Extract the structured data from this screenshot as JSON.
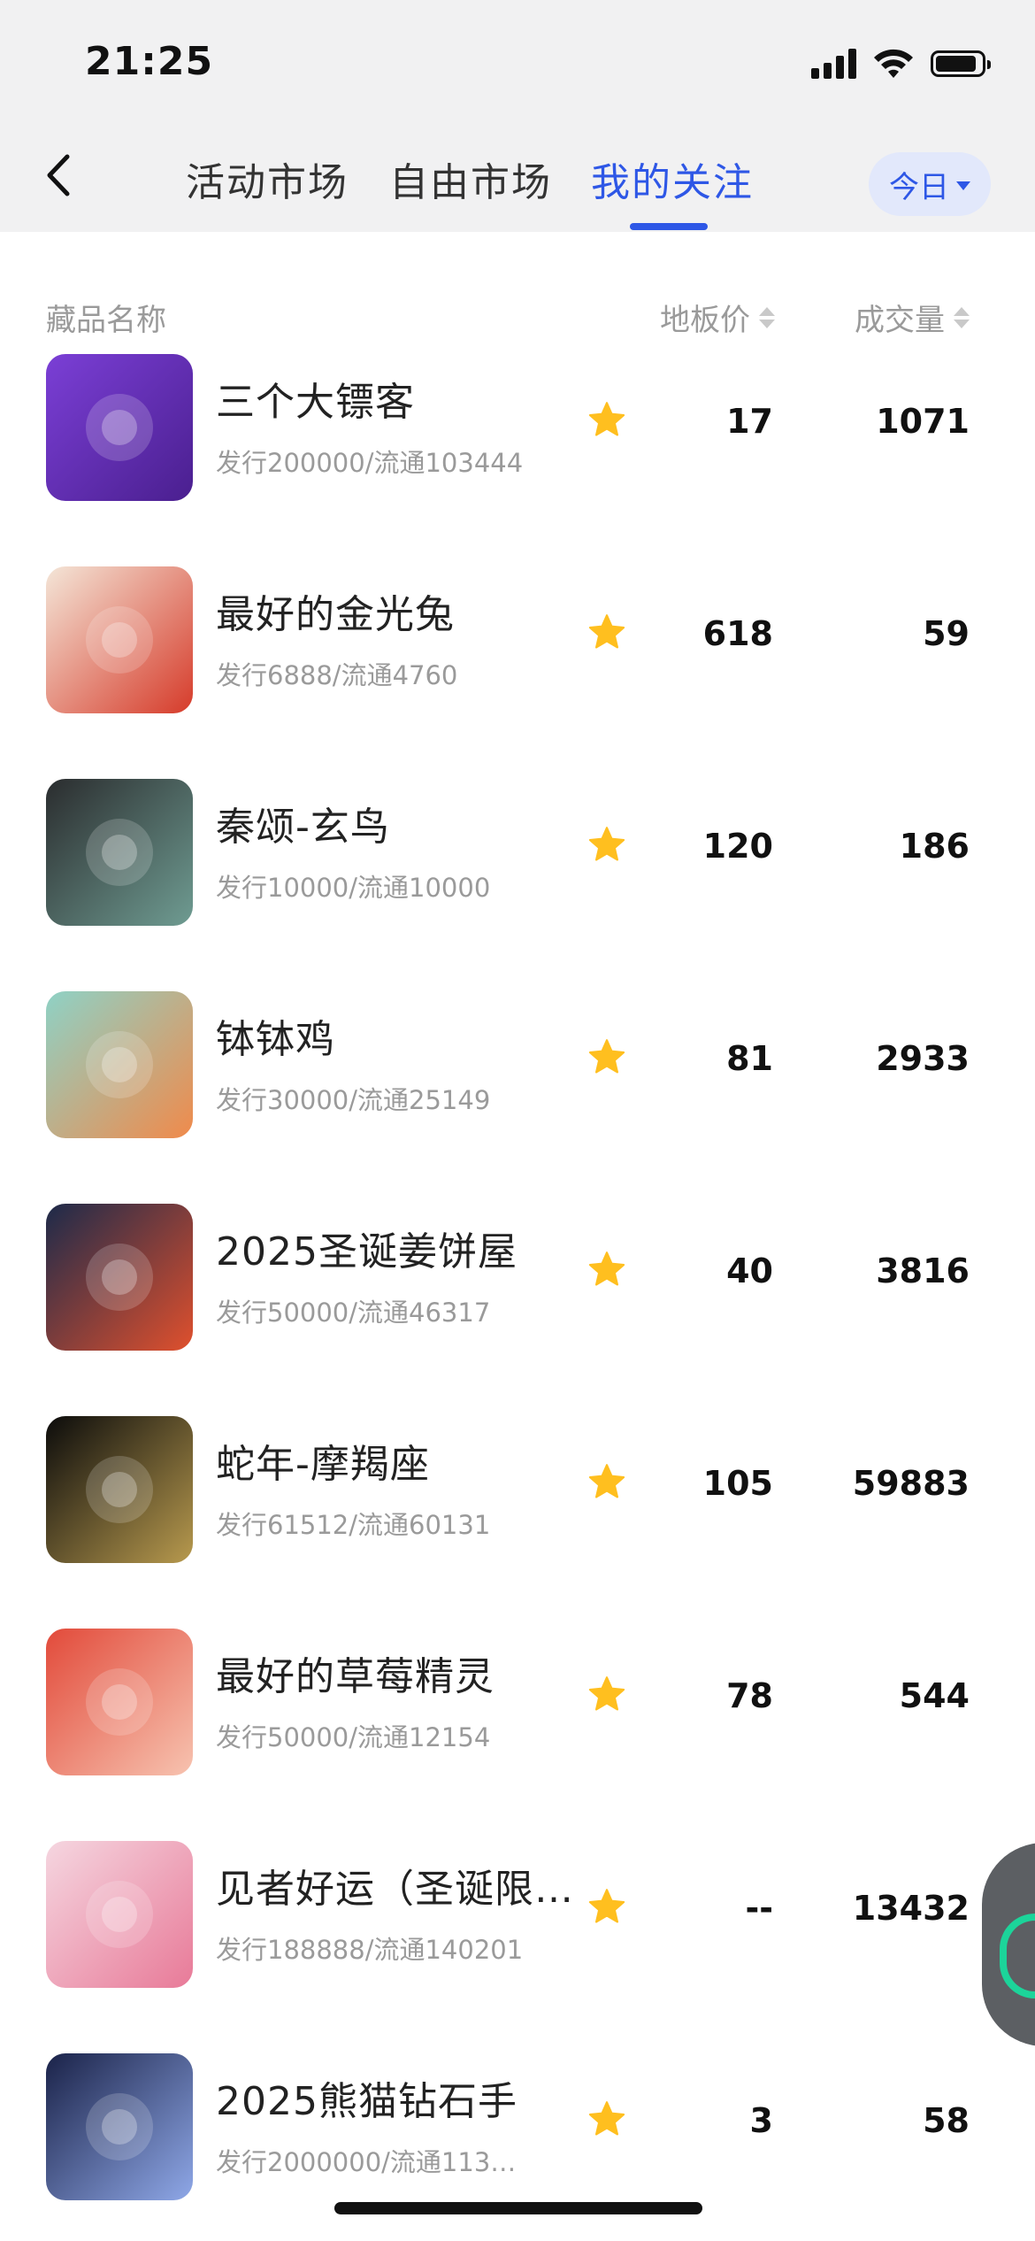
{
  "status_bar": {
    "time": "21:25"
  },
  "nav": {
    "tabs": [
      {
        "label": "活动市场"
      },
      {
        "label": "自由市场"
      },
      {
        "label": "我的关注"
      }
    ],
    "active_tab": "我的关注",
    "period_button": "今日"
  },
  "columns": {
    "name": "藏品名称",
    "floor_price": "地板价",
    "volume": "成交量"
  },
  "items": [
    {
      "name": "三个大镖客",
      "supply": "发行200000/流通103444",
      "price": "17",
      "volume": "1071",
      "thumb_bg": [
        "#7b3fd6",
        "#4a1f8f"
      ]
    },
    {
      "name": "最好的金光兔",
      "supply": "发行6888/流通4760",
      "price": "618",
      "volume": "59",
      "thumb_bg": [
        "#f4e6d8",
        "#d63b2a"
      ]
    },
    {
      "name": "秦颂-玄鸟",
      "supply": "发行10000/流通10000",
      "price": "120",
      "volume": "186",
      "thumb_bg": [
        "#2a2c2e",
        "#6f9c92"
      ]
    },
    {
      "name": "钵钵鸡",
      "supply": "发行30000/流通25149",
      "price": "81",
      "volume": "2933",
      "thumb_bg": [
        "#8ed2c6",
        "#f08a4b"
      ]
    },
    {
      "name": "2025圣诞姜饼屋",
      "supply": "发行50000/流通46317",
      "price": "40",
      "volume": "3816",
      "thumb_bg": [
        "#1c2a4a",
        "#e0502d"
      ]
    },
    {
      "name": "蛇年-摩羯座",
      "supply": "发行61512/流通60131",
      "price": "105",
      "volume": "59883",
      "thumb_bg": [
        "#0b0b0b",
        "#b89a4e"
      ]
    },
    {
      "name": "最好的草莓精灵",
      "supply": "发行50000/流通12154",
      "price": "78",
      "volume": "544",
      "thumb_bg": [
        "#e24a3a",
        "#f7c3b0"
      ]
    },
    {
      "name": "见者好运（圣诞限…",
      "supply": "发行188888/流通140201",
      "price": "--",
      "volume": "13432",
      "thumb_bg": [
        "#f5d6e0",
        "#e87a98"
      ]
    },
    {
      "name": "2025熊猫钻石手",
      "supply": "发行2000000/流通113…",
      "price": "3",
      "volume": "58",
      "thumb_bg": [
        "#1a2248",
        "#8fa8e8"
      ]
    }
  ],
  "colors": {
    "accent": "#2e57e6",
    "star": "#ffbf1f"
  }
}
